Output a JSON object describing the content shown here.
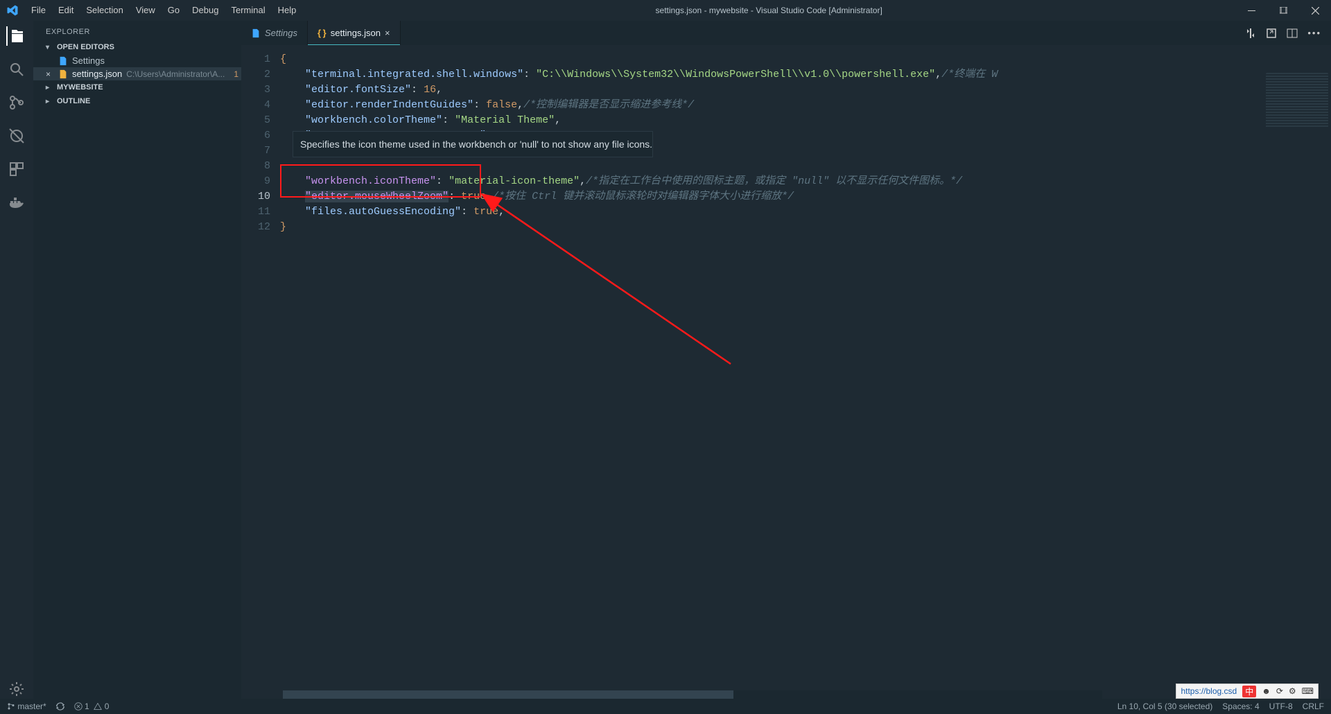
{
  "titlebar": {
    "title": "settings.json - mywebsite - Visual Studio Code [Administrator]",
    "menu": [
      "File",
      "Edit",
      "Selection",
      "View",
      "Go",
      "Debug",
      "Terminal",
      "Help"
    ]
  },
  "sidebar": {
    "header": "EXPLORER",
    "sections": {
      "open_editors": "OPEN EDITORS",
      "workspace": "MYWEBSITE",
      "outline": "OUTLINE"
    },
    "open_editors_items": [
      {
        "name": "Settings",
        "icon": "file-icon"
      },
      {
        "name": "settings.json",
        "icon": "json-icon",
        "path": "C:\\Users\\Administrator\\A...",
        "badge": "1",
        "active": true
      }
    ]
  },
  "tabs": [
    {
      "label": "Settings",
      "icon": "file-icon",
      "italic": true
    },
    {
      "label": "settings.json",
      "icon": "json-icon",
      "active": true,
      "dirty": false
    }
  ],
  "hover_tip": "Specifies the icon theme used in the workbench or 'null' to not show any file icons.",
  "code_lines": [
    {
      "n": 1,
      "i": 0,
      "parts": [
        {
          "t": "{",
          "c": "brace"
        }
      ]
    },
    {
      "n": 2,
      "i": 1,
      "parts": [
        {
          "t": "\"terminal.integrated.shell.windows\"",
          "c": "key"
        },
        {
          "t": ": ",
          "c": "punc"
        },
        {
          "t": "\"C:\\\\Windows\\\\System32\\\\WindowsPowerShell\\\\v1.0\\\\powershell.exe\"",
          "c": "str"
        },
        {
          "t": ",",
          "c": "punc"
        },
        {
          "t": "/*终端在 W",
          "c": "cmt"
        }
      ]
    },
    {
      "n": 3,
      "i": 1,
      "parts": [
        {
          "t": "\"editor.fontSize\"",
          "c": "key"
        },
        {
          "t": ": ",
          "c": "punc"
        },
        {
          "t": "16",
          "c": "num"
        },
        {
          "t": ",",
          "c": "punc"
        }
      ]
    },
    {
      "n": 4,
      "i": 1,
      "parts": [
        {
          "t": "\"editor.renderIndentGuides\"",
          "c": "key"
        },
        {
          "t": ": ",
          "c": "punc"
        },
        {
          "t": "false",
          "c": "bool"
        },
        {
          "t": ",",
          "c": "punc"
        },
        {
          "t": "/*控制编辑器是否显示缩进参考线*/",
          "c": "cmt"
        }
      ]
    },
    {
      "n": 5,
      "i": 1,
      "parts": [
        {
          "t": "\"workbench.colorTheme\"",
          "c": "key"
        },
        {
          "t": ": ",
          "c": "punc"
        },
        {
          "t": "\"Material Theme\"",
          "c": "str"
        },
        {
          "t": ",",
          "c": "punc"
        }
      ]
    },
    {
      "n": 6,
      "i": 1,
      "parts": [
        {
          "t": "\"atomKeymap.promptV3Features\"",
          "c": "key"
        },
        {
          "t": ": ",
          "c": "punc"
        },
        {
          "t": "true",
          "c": "bool"
        },
        {
          "t": ",",
          "c": "punc"
        }
      ]
    },
    {
      "n": 7,
      "i": 1,
      "parts": []
    },
    {
      "n": 8,
      "i": 1,
      "parts": []
    },
    {
      "n": 9,
      "i": 1,
      "parts": [
        {
          "t": "\"workbench.iconTheme\"",
          "c": "keyH"
        },
        {
          "t": ": ",
          "c": "punc"
        },
        {
          "t": "\"material-icon-theme\"",
          "c": "str"
        },
        {
          "t": ",",
          "c": "punc"
        },
        {
          "t": "/*指定在工作台中使用的图标主题，或指定 \"null\" 以不显示任何文件图标。*/",
          "c": "cmt"
        }
      ]
    },
    {
      "n": 10,
      "i": 1,
      "current": true,
      "selected_key": true,
      "parts": [
        {
          "t": "\"editor.mouseWheelZoom\"",
          "c": "keyH"
        },
        {
          "t": ": ",
          "c": "punc"
        },
        {
          "t": "true",
          "c": "bool"
        },
        {
          "t": ",",
          "c": "punc"
        },
        {
          "t": "/*按住 Ctrl 键并滚动鼠标滚轮时对编辑器字体大小进行缩放*/",
          "c": "cmt"
        }
      ]
    },
    {
      "n": 11,
      "i": 1,
      "parts": [
        {
          "t": "\"files.autoGuessEncoding\"",
          "c": "key"
        },
        {
          "t": ": ",
          "c": "punc"
        },
        {
          "t": "true",
          "c": "bool"
        },
        {
          "t": ",",
          "c": "punc"
        }
      ]
    },
    {
      "n": 12,
      "i": 0,
      "parts": [
        {
          "t": "}",
          "c": "brace"
        }
      ]
    }
  ],
  "statusbar": {
    "branch": "master*",
    "errors": "1",
    "warnings": "0",
    "cursor": "Ln 10, Col 5 (30 selected)",
    "spaces": "Spaces: 4",
    "encoding": "UTF-8",
    "eol": "CRLF"
  },
  "ime": {
    "url": "https://blog.csd",
    "lang": "中"
  }
}
